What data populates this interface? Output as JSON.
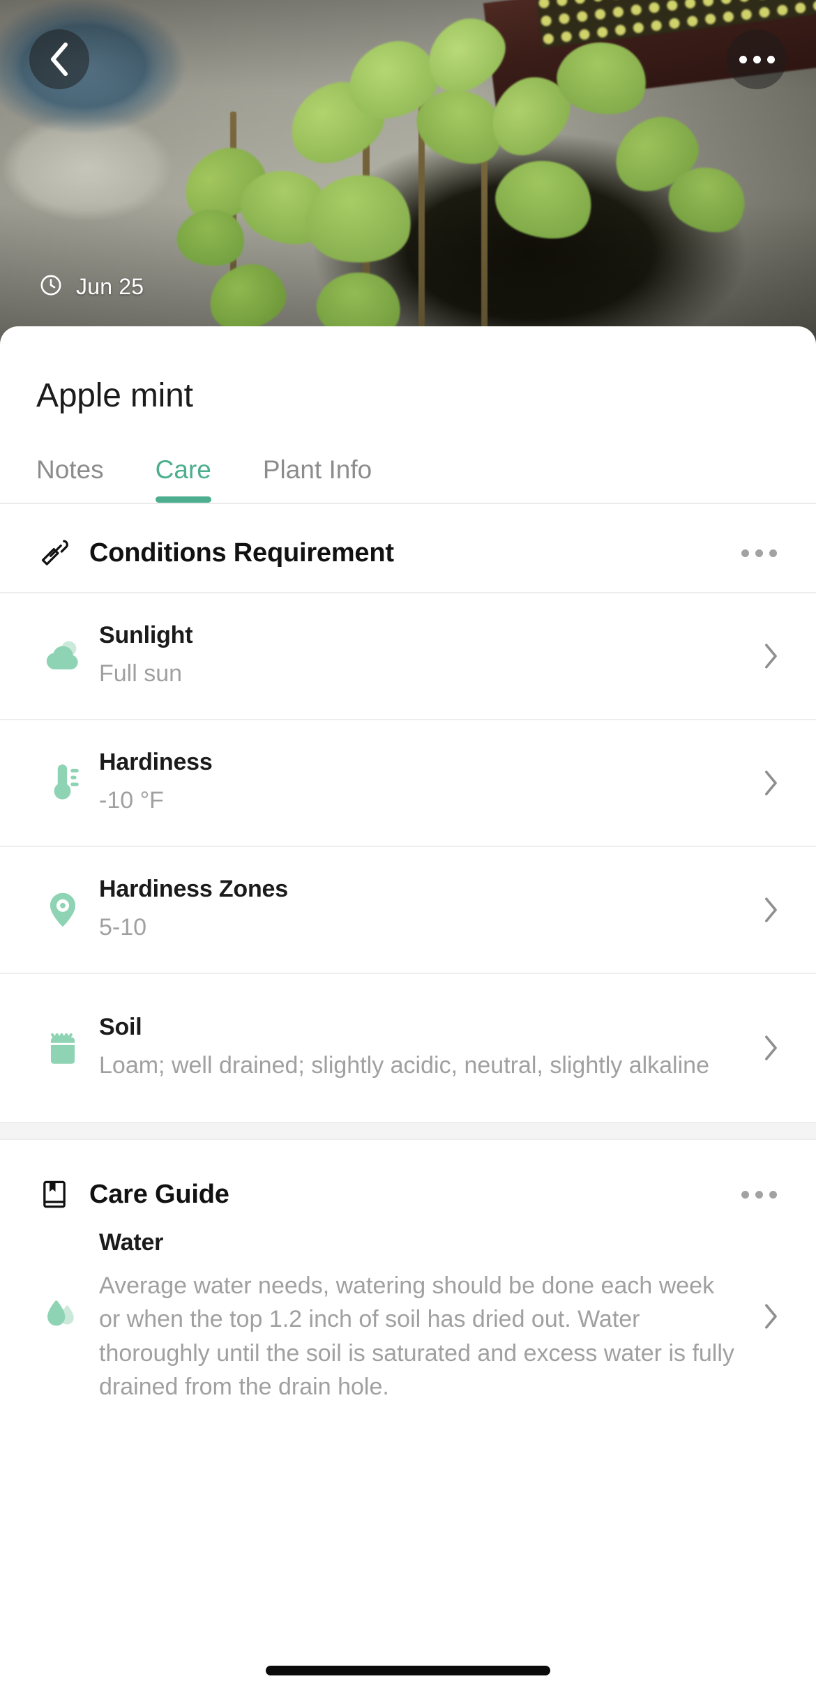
{
  "hero": {
    "back_icon": "chevron-left-icon",
    "more_icon": "more-horizontal-icon",
    "clock_icon": "clock-icon",
    "date": "Jun 25"
  },
  "header": {
    "title": "Apple mint"
  },
  "tabs": [
    {
      "label": "Notes",
      "active": false
    },
    {
      "label": "Care",
      "active": true
    },
    {
      "label": "Plant Info",
      "active": false
    }
  ],
  "conditions": {
    "icon": "trowel-icon",
    "title": "Conditions Requirement",
    "more_icon": "more-horizontal-icon",
    "rows": [
      {
        "icon": "sun-cloud-icon",
        "label": "Sunlight",
        "value": "Full sun",
        "chevron": "chevron-right-icon"
      },
      {
        "icon": "thermometer-icon",
        "label": "Hardiness",
        "value": "-10 °F",
        "chevron": "chevron-right-icon"
      },
      {
        "icon": "map-pin-icon",
        "label": "Hardiness Zones",
        "value": "5-10",
        "chevron": "chevron-right-icon"
      },
      {
        "icon": "soil-bag-icon",
        "label": "Soil",
        "value": "Loam; well drained; slightly acidic, neutral, slightly alkaline",
        "chevron": "chevron-right-icon"
      }
    ]
  },
  "care_guide": {
    "icon": "book-icon",
    "title": "Care Guide",
    "more_icon": "more-horizontal-icon",
    "items": [
      {
        "icon": "water-drop-icon",
        "label": "Water",
        "text": "Average water needs, watering should be done each week or when the top 1.2 inch of soil has dried out. Water thoroughly until the soil is saturated and excess water is fully drained from the drain hole.",
        "chevron": "chevron-right-icon"
      }
    ]
  },
  "colors": {
    "accent": "#4CAE8E",
    "icon_green": "#8ed3b3",
    "icon_green_light": "#cbe9da",
    "title": "#1b1b1b",
    "muted": "#a0a0a0",
    "tab_inactive": "#8c8c8c",
    "divider": "#ededed",
    "band": "#f4f4f4"
  }
}
